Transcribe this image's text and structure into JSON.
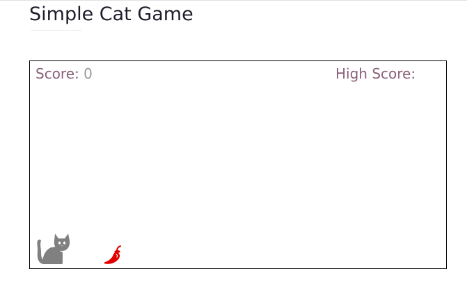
{
  "page": {
    "title": "Simple Cat Game"
  },
  "game": {
    "score_label": "Score:",
    "score_value": "0",
    "high_score_label": "High Score:",
    "high_score_value": "",
    "player_icon": "cat-icon",
    "item_icon": "chili-pepper-icon"
  },
  "colors": {
    "label_color": "#8a5f78",
    "score_value_color": "#9a9a9a",
    "cat_color": "#808080",
    "cat_eyes": "#ffffff",
    "pepper_color": "#e00000",
    "board_border": "#000000"
  }
}
